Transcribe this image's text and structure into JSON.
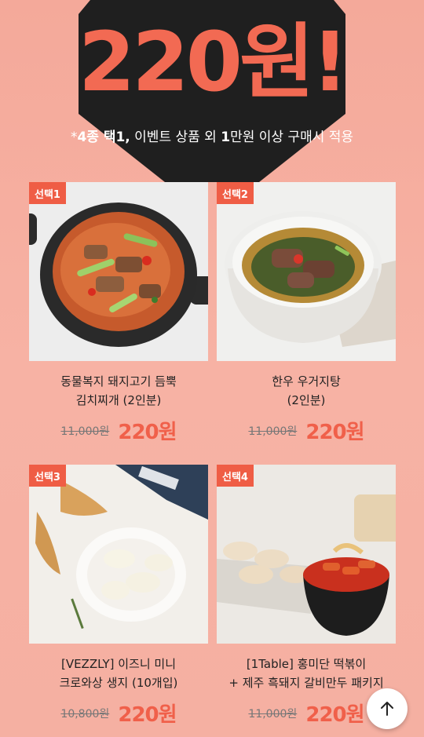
{
  "banner": {
    "headline": "220원!",
    "note_prefix": "*",
    "note_bold1": "4종 택1,",
    "note_mid": " 이벤트 상품 외 ",
    "note_bold2": "1",
    "note_suffix": "만원 이상 구매시 적용"
  },
  "products": [
    {
      "badge": "선택1",
      "title_line1": "동물복지 돼지고기 듬뿍",
      "title_line2": "김치찌개 (2인분)",
      "old_price": "11,000원",
      "new_price": "220원"
    },
    {
      "badge": "선택2",
      "title_line1": "한우 우거지탕",
      "title_line2": "(2인분)",
      "old_price": "11,000원",
      "new_price": "220원"
    },
    {
      "badge": "선택3",
      "title_line1": "[VEZZLY] 이즈니 미니",
      "title_line2": "크로와상 생지 (10개입)",
      "old_price": "10,800원",
      "new_price": "220원"
    },
    {
      "badge": "선택4",
      "title_line1": "[1Table] 홍미단 떡볶이",
      "title_line2": "+ 제주 흑돼지 갈비만두 패키지",
      "old_price": "11,000원",
      "new_price": "220원"
    }
  ],
  "colors": {
    "accent": "#ef5d45",
    "background": "#f4a99a",
    "banner_dark": "#1f1f1f"
  },
  "icons": {
    "scroll_top": "arrow-up-icon"
  }
}
